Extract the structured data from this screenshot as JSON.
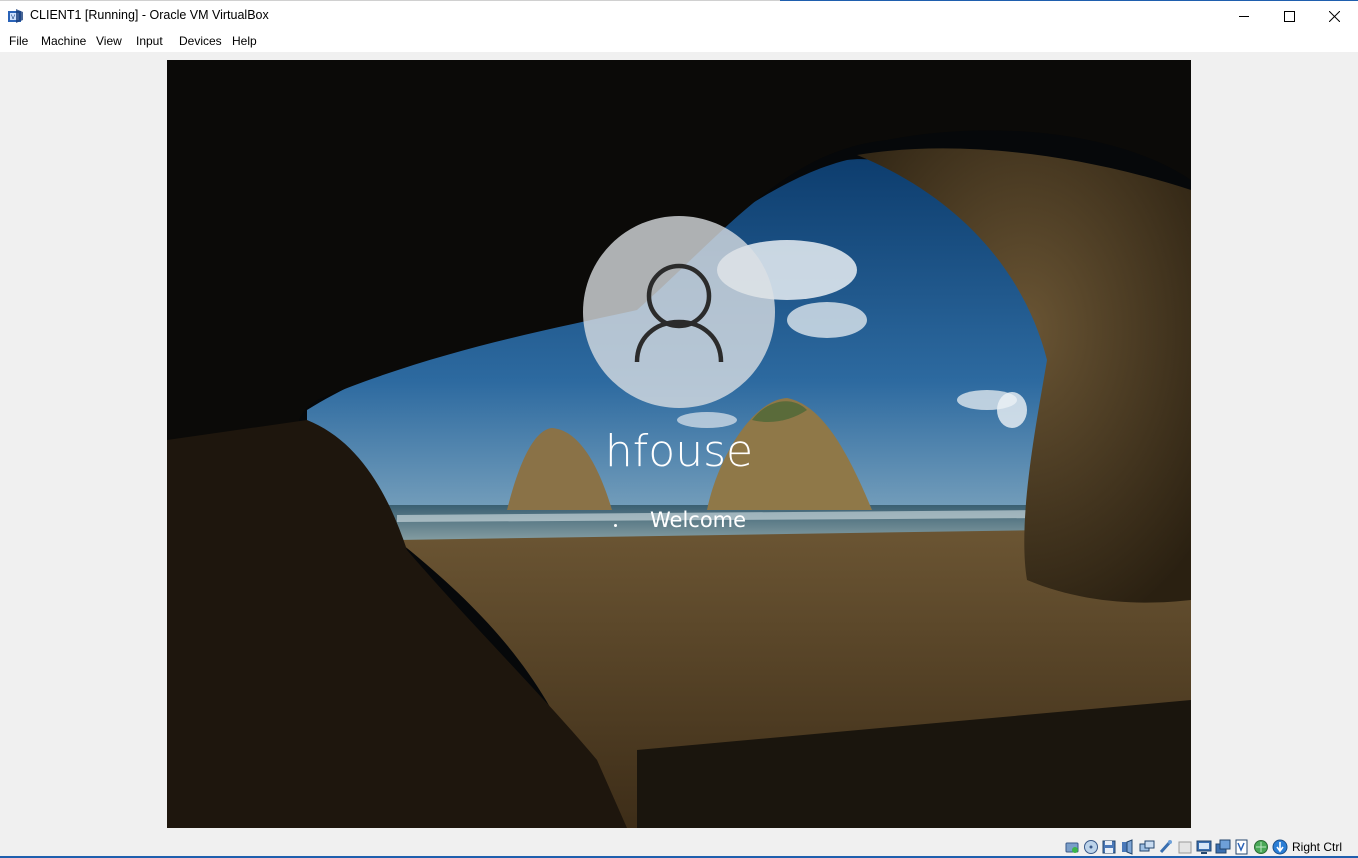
{
  "window": {
    "title": "CLIENT1 [Running] - Oracle VM VirtualBox",
    "app_icon": "virtualbox-icon"
  },
  "controls": {
    "minimize": "minimize-icon",
    "maximize": "maximize-icon",
    "close": "close-icon"
  },
  "menu": {
    "items": [
      "File",
      "Machine",
      "View",
      "Input",
      "Devices",
      "Help"
    ]
  },
  "guest": {
    "username": "hfouse",
    "status": "Welcome",
    "avatar_icon": "user-icon"
  },
  "statusbar": {
    "icons": [
      "hard-disk-icon",
      "optical-drive-icon",
      "floppy-icon",
      "audio-icon",
      "network-icon",
      "usb-icon",
      "shared-folders-icon",
      "display-icon",
      "video-capture-icon",
      "virtualization-icon",
      "cpu-icon",
      "mouse-integration-icon",
      "keyboard-capture-icon"
    ],
    "host_key": "Right Ctrl"
  },
  "colors": {
    "accent": "#1f5fae",
    "chrome": "#f0f0f0"
  }
}
